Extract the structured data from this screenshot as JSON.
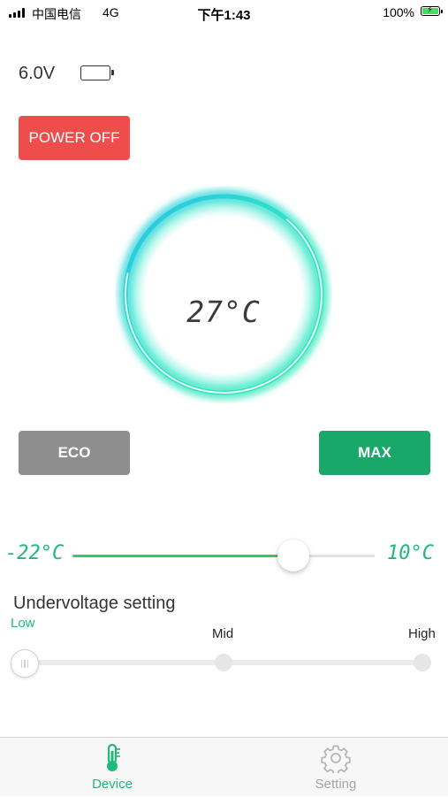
{
  "status_bar": {
    "carrier": "中国电信",
    "network": "4G",
    "time": "下午1:43",
    "battery_percent": "100%"
  },
  "device": {
    "voltage": "6.0V",
    "power_button": "POWER OFF",
    "current_temperature": "27°C",
    "eco_button": "ECO",
    "max_button": "MAX"
  },
  "temperature_slider": {
    "min_label": "-22°C",
    "max_label": "10°C",
    "level_fraction": 0.73
  },
  "undervoltage": {
    "title": "Undervoltage setting",
    "options": [
      "Low",
      "Mid",
      "High"
    ],
    "selected": "Low"
  },
  "tab_bar": {
    "tabs": [
      {
        "label": "Device",
        "icon": "thermometer-icon",
        "active": true
      },
      {
        "label": "Setting",
        "icon": "gear-icon",
        "active": false
      }
    ]
  },
  "colors": {
    "accent_green": "#1fba7a",
    "power_red": "#ef4c4c",
    "eco_gray": "#8e8e8e",
    "max_green": "#1aa76a",
    "dial_glow": "#2ee6c8"
  }
}
